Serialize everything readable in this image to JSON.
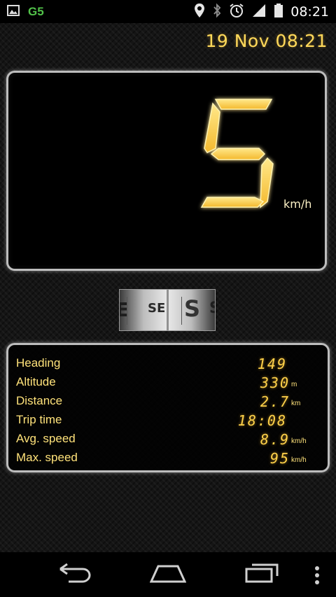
{
  "status_bar": {
    "left_icons": [
      "image-icon",
      "gs-app-icon"
    ],
    "gs_label": "G5",
    "right_icons": [
      "location-icon",
      "bluetooth-icon",
      "alarm-icon",
      "signal-icon",
      "battery-icon"
    ],
    "time": "08:21"
  },
  "header": {
    "datetime": "19 Nov 08:21"
  },
  "speedometer": {
    "speed": "5",
    "unit": "km/h"
  },
  "compass": {
    "letters": [
      "E",
      "SE",
      "S",
      "S"
    ],
    "highlight": "SE"
  },
  "stats": [
    {
      "label": "Heading",
      "value": "149",
      "unit": ""
    },
    {
      "label": "Altitude",
      "value": "330",
      "unit": "m"
    },
    {
      "label": "Distance",
      "value": "2.7",
      "unit": "km"
    },
    {
      "label": "Trip time",
      "value": "18:08",
      "unit": ""
    },
    {
      "label": "Avg. speed",
      "value": "8.9",
      "unit": "km/h"
    },
    {
      "label": "Max. speed",
      "value": "95",
      "unit": "km/h"
    }
  ],
  "navigation": {
    "icons": [
      "back-icon",
      "home-icon",
      "recents-icon",
      "overflow-menu-icon"
    ]
  },
  "colors": {
    "accent": "#ffd24a",
    "label": "#ffe27a",
    "panel_border": "#bdbdbd"
  }
}
